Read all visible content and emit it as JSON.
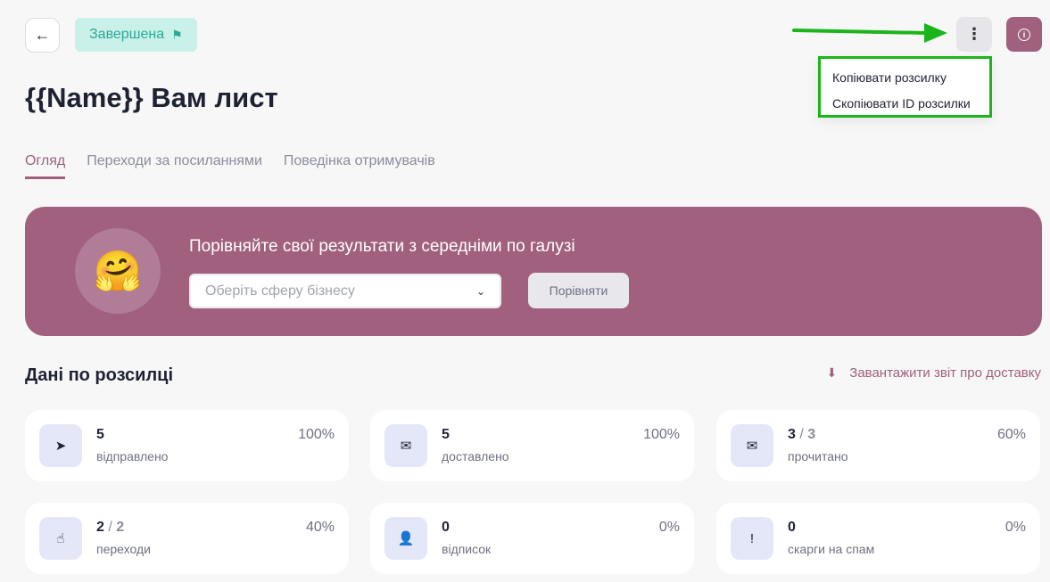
{
  "header": {
    "back_icon": "←",
    "status": "Завершена",
    "flag_icon": "⚑",
    "more_icon": "⋮",
    "info_icon": "i"
  },
  "dropdown": {
    "items": [
      "Копіювати розсилку",
      "Скопіювати ID розсилки"
    ]
  },
  "title": "{{Name}} Вам лист",
  "tabs": [
    {
      "label": "Огляд",
      "active": true
    },
    {
      "label": "Переходи за посиланнями"
    },
    {
      "label": "Поведінка отримувачів"
    }
  ],
  "banner": {
    "emoji": "🤗",
    "title": "Порівняйте свої результати з середніми по галузі",
    "select_placeholder": "Оберіть сферу бізнесу",
    "chevron": "⌄",
    "compare_label": "Порівняти"
  },
  "section": {
    "title": "Дані по розсилці",
    "download_icon": "⬇",
    "download_label": "Завантажити звіт про доставку"
  },
  "stats": [
    {
      "icon": "➤",
      "value": "5",
      "total": "",
      "label": "відправлено",
      "pct": "100%"
    },
    {
      "icon": "✉",
      "value": "5",
      "total": "",
      "label": "доставлено",
      "pct": "100%"
    },
    {
      "icon": "✉",
      "value": "3",
      "total": "3",
      "label": "прочитано",
      "pct": "60%"
    },
    {
      "icon": "☝",
      "value": "2",
      "total": "2",
      "label": "переходи",
      "pct": "40%"
    },
    {
      "icon": "👤",
      "value": "0",
      "total": "",
      "label": "відписок",
      "pct": "0%"
    },
    {
      "icon": "!",
      "value": "0",
      "total": "",
      "label": "скарги на спам",
      "pct": "0%"
    }
  ],
  "colors": {
    "accent": "#a0607e",
    "status_bg": "#c9f1ea",
    "status_text": "#2ba896",
    "highlight": "#1bb51b"
  }
}
